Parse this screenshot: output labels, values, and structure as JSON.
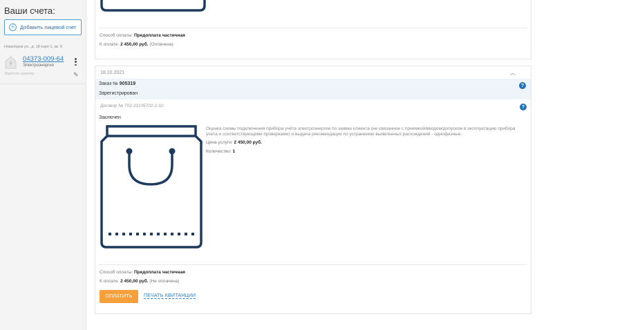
{
  "sidebar": {
    "title": "Ваши счета:",
    "add_account_label": "Добавить лицевой счет",
    "account": {
      "address": "Новаторов ул., д. 18 корп 1, кв. 9",
      "number": "04373-009-64",
      "type": "Электроэнергия",
      "hint": "Введите заметку"
    }
  },
  "card_top": {
    "payment_method_label": "Способ оплаты:",
    "payment_method_value": "Предоплата частичная",
    "amount_label": "К оплате:",
    "amount_value": "2 450,00 руб.",
    "amount_status": "(Оплачена)"
  },
  "order": {
    "date": "18.10.2021",
    "order_label": "Заказ №",
    "order_number": "905319",
    "order_status": "Зарегистрирован",
    "contract": "Договор № 702-21105702-2-10",
    "contract_status": "Заключен",
    "description": "Оценка схемы подключения прибора учёта электроэнергии по заявке клиента (не связанное с приемкой/вводом/допуском в эксплуатацию прибора учета и соответствующими проверками) и выдача рекомендации по устранению выявленных расхождений - однофазные.",
    "price_label": "Цена услуги:",
    "price_value": "2 450,00 руб.",
    "qty_label": "Количество:",
    "qty_value": "1",
    "payment_method_label": "Способ оплаты:",
    "payment_method_value": "Предоплата частичная",
    "amount_label": "К оплате:",
    "amount_value": "2 450,00 руб.",
    "amount_status": "(Не оплачена)",
    "pay_button": "ОПЛАТИТЬ",
    "print_link": "ПЕЧАТЬ КВИТАНЦИИ"
  },
  "colors": {
    "accent": "#1d72b8",
    "pay_button": "#f5a03a",
    "bag_stroke": "#1f3a5f"
  }
}
